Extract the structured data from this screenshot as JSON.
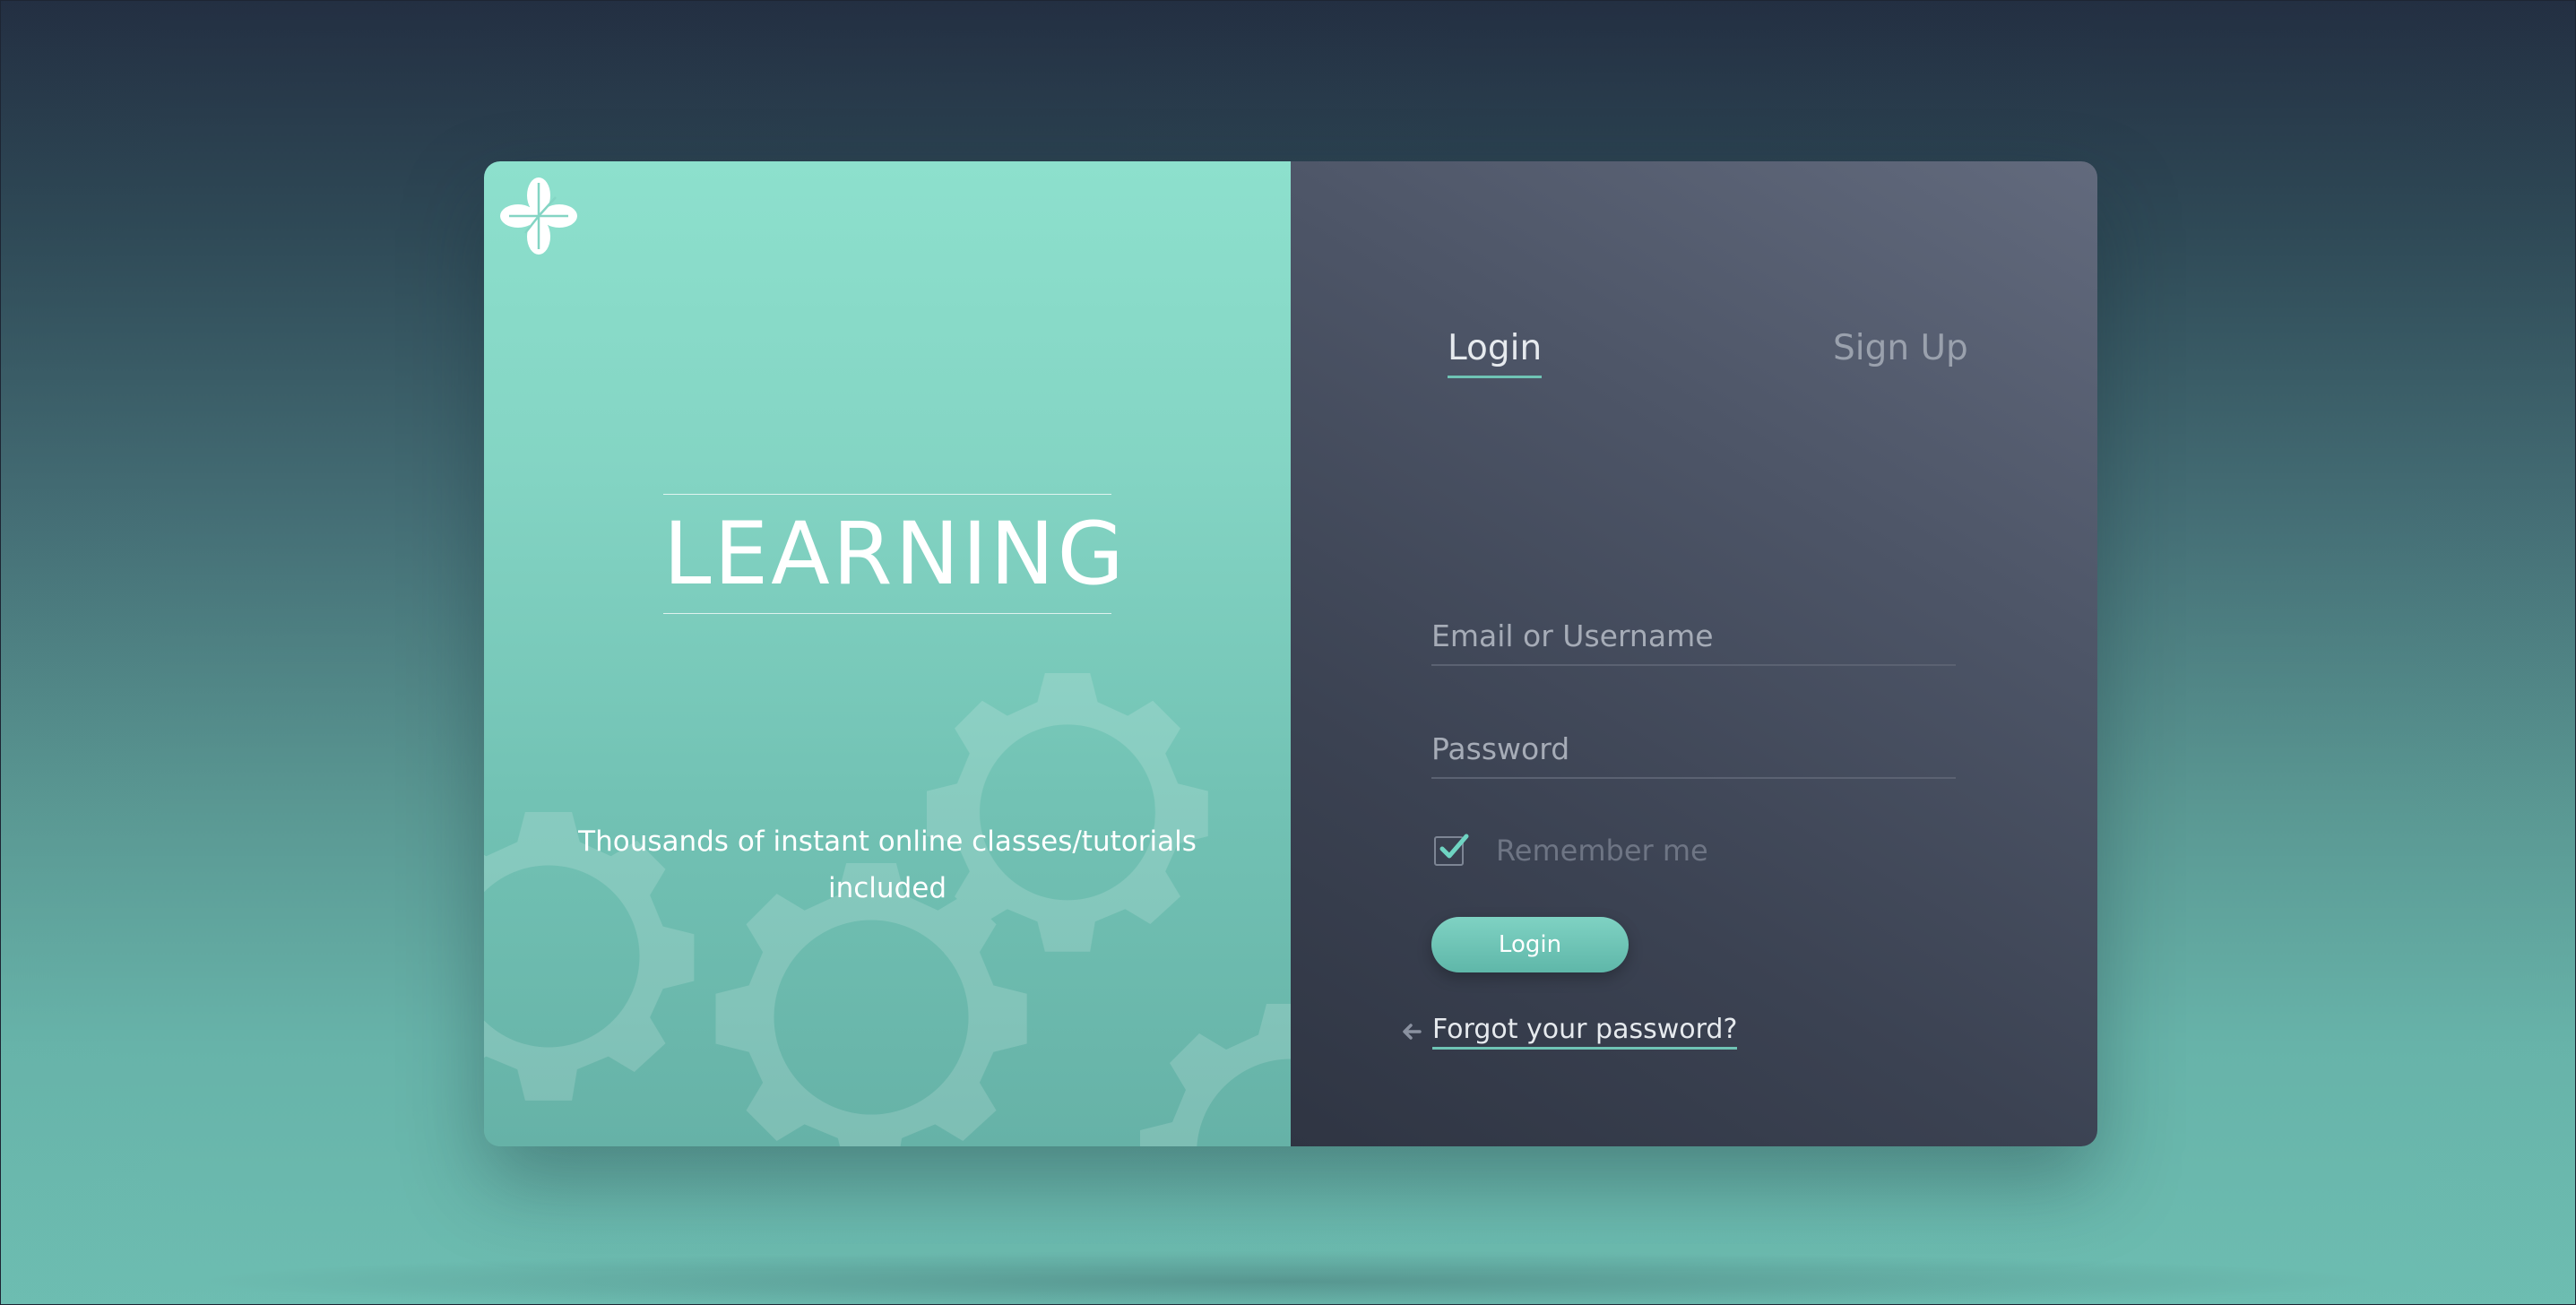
{
  "hero": {
    "title": "LEARNING",
    "tagline_line1": "Thousands of instant online classes/tutorials",
    "tagline_line2": "included",
    "logo_icon": "flower-logo-icon",
    "decoration_icon": "gear-icon"
  },
  "auth": {
    "tabs": {
      "login_label": "Login",
      "signup_label": "Sign Up",
      "active": "login"
    },
    "email_placeholder": "Email or Username",
    "password_placeholder": "Password",
    "remember_label": "Remember me",
    "remember_checked": true,
    "submit_label": "Login",
    "forgot_label": "Forgot your password?",
    "forgot_icon": "arrow-left-icon"
  },
  "colors": {
    "accent": "#6fc4b5",
    "hero_bg": "#84d5c4",
    "panel_bg": "#4d5567",
    "page_top": "#232f42",
    "page_bottom": "#6dbdb1"
  }
}
